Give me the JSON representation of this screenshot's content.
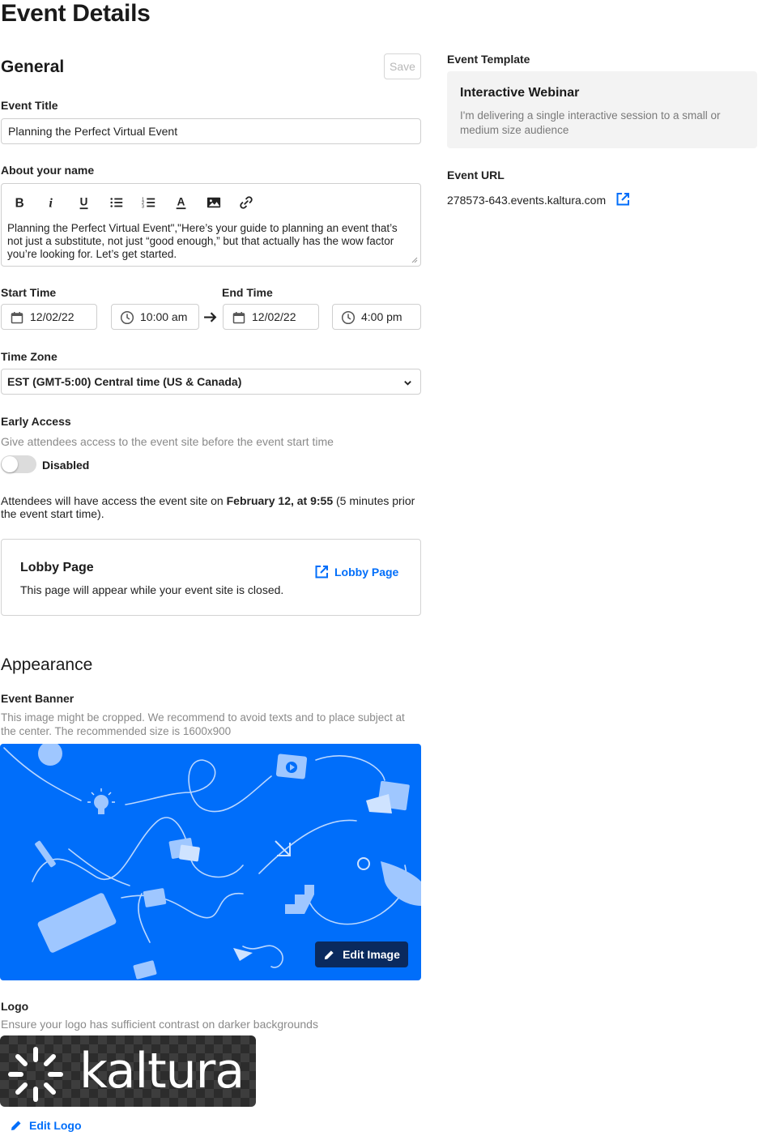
{
  "page": {
    "title": "Event Details"
  },
  "general": {
    "heading": "General",
    "save_label": "Save",
    "event_title": {
      "label": "Event Title",
      "value": "Planning the Perfect Virtual Event"
    },
    "about": {
      "label": "About your name",
      "text": "Planning the Perfect Virtual Event\",\"Here’s your guide to planning an event that’s not just a substitute, not just “good enough,” but that actually has the wow factor you’re looking for. Let’s get started."
    },
    "start_time": {
      "label": "Start Time",
      "date": "12/02/22",
      "time": "10:00 am"
    },
    "end_time": {
      "label": "End Time",
      "date": "12/02/22",
      "time": "4:00 pm"
    },
    "timezone": {
      "label": "Time Zone",
      "value": "EST (GMT-5:00) Central time (US & Canada)"
    },
    "early_access": {
      "label": "Early Access",
      "help": "Give attendees access to the event site before the event start time",
      "toggle_state": "Disabled",
      "note_prefix": "Attendees will have access the event site on ",
      "note_bold": "February 12, at 9:55",
      "note_suffix": " (5 minutes prior the event start time)."
    },
    "lobby": {
      "title": "Lobby Page",
      "description": "This page will appear while your event site is closed.",
      "link_label": "Lobby Page"
    }
  },
  "appearance": {
    "heading": "Appearance",
    "banner": {
      "label": "Event Banner",
      "help": "This image might be cropped. We recommend to avoid texts and to place subject at the center. The recommended size is 1600x900",
      "edit_label": "Edit Image",
      "bg_color": "#006efa"
    },
    "logo": {
      "label": "Logo",
      "help": "Ensure your logo has sufficient contrast on darker backgrounds",
      "logo_text": "kaltura",
      "edit_label": "Edit Logo"
    }
  },
  "sidebar": {
    "template": {
      "label": "Event Template",
      "name": "Interactive Webinar",
      "description": "I'm delivering a single interactive session to a small or medium size audience"
    },
    "url": {
      "label": "Event URL",
      "value": "278573-643.events.kaltura.com"
    }
  },
  "colors": {
    "accent": "#006efa",
    "dark_button": "#0a2a5e"
  }
}
